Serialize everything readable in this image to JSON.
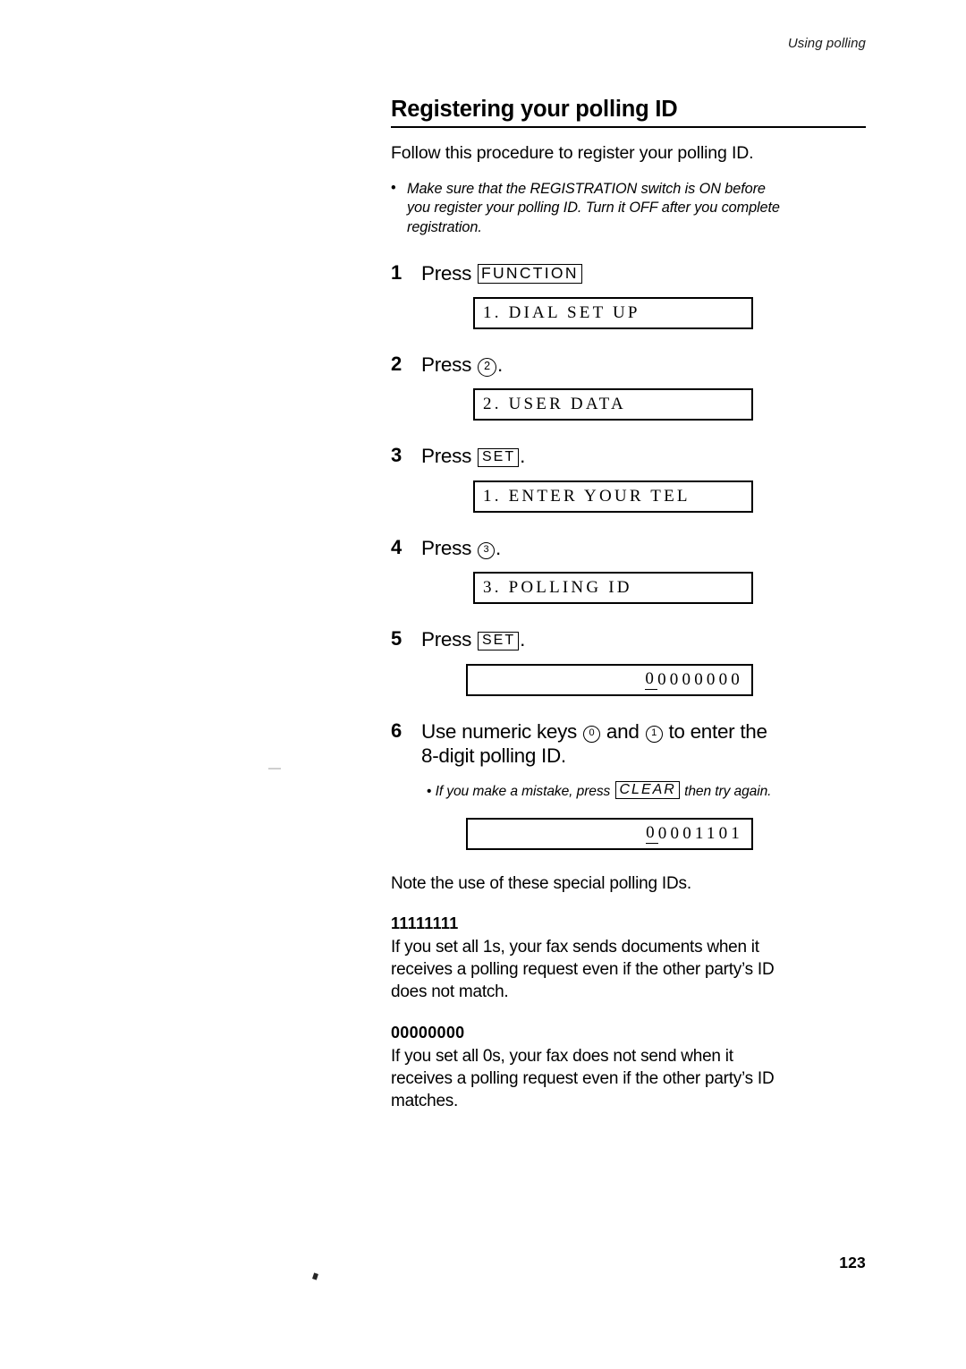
{
  "running_head": "Using polling",
  "page_number": "123",
  "section": {
    "title": "Registering your polling ID",
    "intro": "Follow this procedure to register your polling ID.",
    "note": {
      "bullet": "•",
      "line1": "Make sure that the REGISTRATION switch is ON before",
      "line2": "you register your polling ID. Turn it OFF after you complete",
      "line3": "registration."
    }
  },
  "steps": [
    {
      "number": "1",
      "press_label": "Press",
      "key": "FUNCTION",
      "trailing": "",
      "lcd": "1. DIAL SET UP",
      "lcd_align": "left"
    },
    {
      "number": "2",
      "press_label": "Press",
      "key_circle": "2",
      "trailing": ".",
      "lcd": "2. USER DATA",
      "lcd_align": "left"
    },
    {
      "number": "3",
      "press_label": "Press",
      "key": "SET",
      "trailing": ".",
      "lcd": "1. ENTER YOUR TEL",
      "lcd_align": "left"
    },
    {
      "number": "4",
      "press_label": "Press",
      "key_circle": "3",
      "trailing": ".",
      "lcd": "3. POLLING ID",
      "lcd_align": "left"
    },
    {
      "number": "5",
      "press_label": "Press",
      "key": "SET",
      "trailing": ".",
      "lcd_cursor_digit": "0",
      "lcd_rest": "0000000",
      "lcd_align": "right"
    }
  ],
  "step6": {
    "number": "6",
    "text_before_key0": "Use numeric keys",
    "key0": "0",
    "text_between_keys": "and",
    "key1": "1",
    "text_after_keys": "to enter the",
    "line2": "8-digit polling ID.",
    "note": {
      "bullet": "•",
      "before_key": "If you make a mistake, press",
      "key": "CLEAR",
      "after_key": "then try again."
    },
    "lcd_cursor_digit": "0",
    "lcd_rest": "0001101"
  },
  "closing": {
    "lead": "Note the use of these special polling IDs.",
    "entries": [
      {
        "heading": "11111111",
        "line1": "If you set all 1s, your fax sends documents when it",
        "line2": "receives a polling request even if the other party’s ID",
        "line3": "does not match."
      },
      {
        "heading": "00000000",
        "line1": "If you set all 0s, your fax does not send when it",
        "line2": "receives a polling request even if the other party’s ID",
        "line3": "matches."
      }
    ]
  }
}
